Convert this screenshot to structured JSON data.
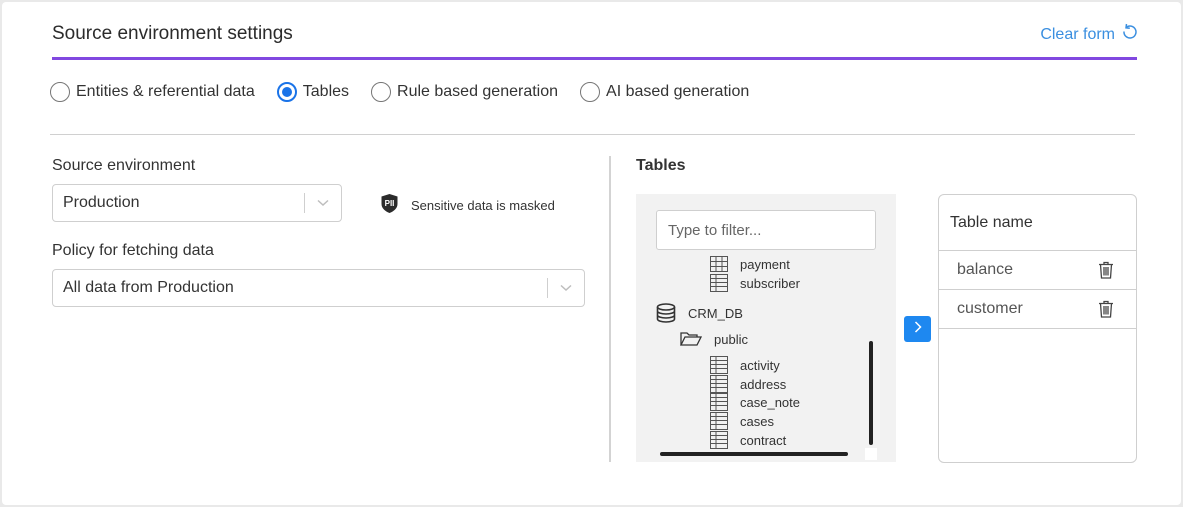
{
  "header": {
    "title": "Source environment settings",
    "clear_form_label": "Clear form",
    "clear_form_icon": "undo-icon",
    "accent_color": "#8148e0",
    "link_color": "#3b8fe0"
  },
  "generation_modes": {
    "options": [
      {
        "label": "Entities & referential data",
        "checked": false
      },
      {
        "label": "Tables",
        "checked": true
      },
      {
        "label": "Rule based generation",
        "checked": false
      },
      {
        "label": "AI based generation",
        "checked": false
      }
    ],
    "selected": "Tables"
  },
  "source_environment": {
    "label": "Source environment",
    "value": "Production",
    "pii_badge": "PII",
    "pii_note": "Sensitive data is masked"
  },
  "policy": {
    "label": "Policy for fetching data",
    "value": "All data from Production"
  },
  "tables": {
    "title": "Tables",
    "filter_placeholder": "Type to filter...",
    "filter_value": "",
    "tree": [
      {
        "type": "table",
        "label": "payment"
      },
      {
        "type": "table",
        "label": "subscriber"
      },
      {
        "type": "database",
        "label": "CRM_DB"
      },
      {
        "type": "schema",
        "label": "public"
      },
      {
        "type": "table",
        "label": "activity"
      },
      {
        "type": "table",
        "label": "address"
      },
      {
        "type": "table",
        "label": "case_note"
      },
      {
        "type": "table",
        "label": "cases"
      },
      {
        "type": "table",
        "label": "contract"
      }
    ],
    "move_button_icon": "chevron-right-icon",
    "move_button_color": "#1e88f0"
  },
  "selected_tables": {
    "header": "Table name",
    "rows": [
      {
        "name": "balance"
      },
      {
        "name": "customer"
      }
    ]
  }
}
